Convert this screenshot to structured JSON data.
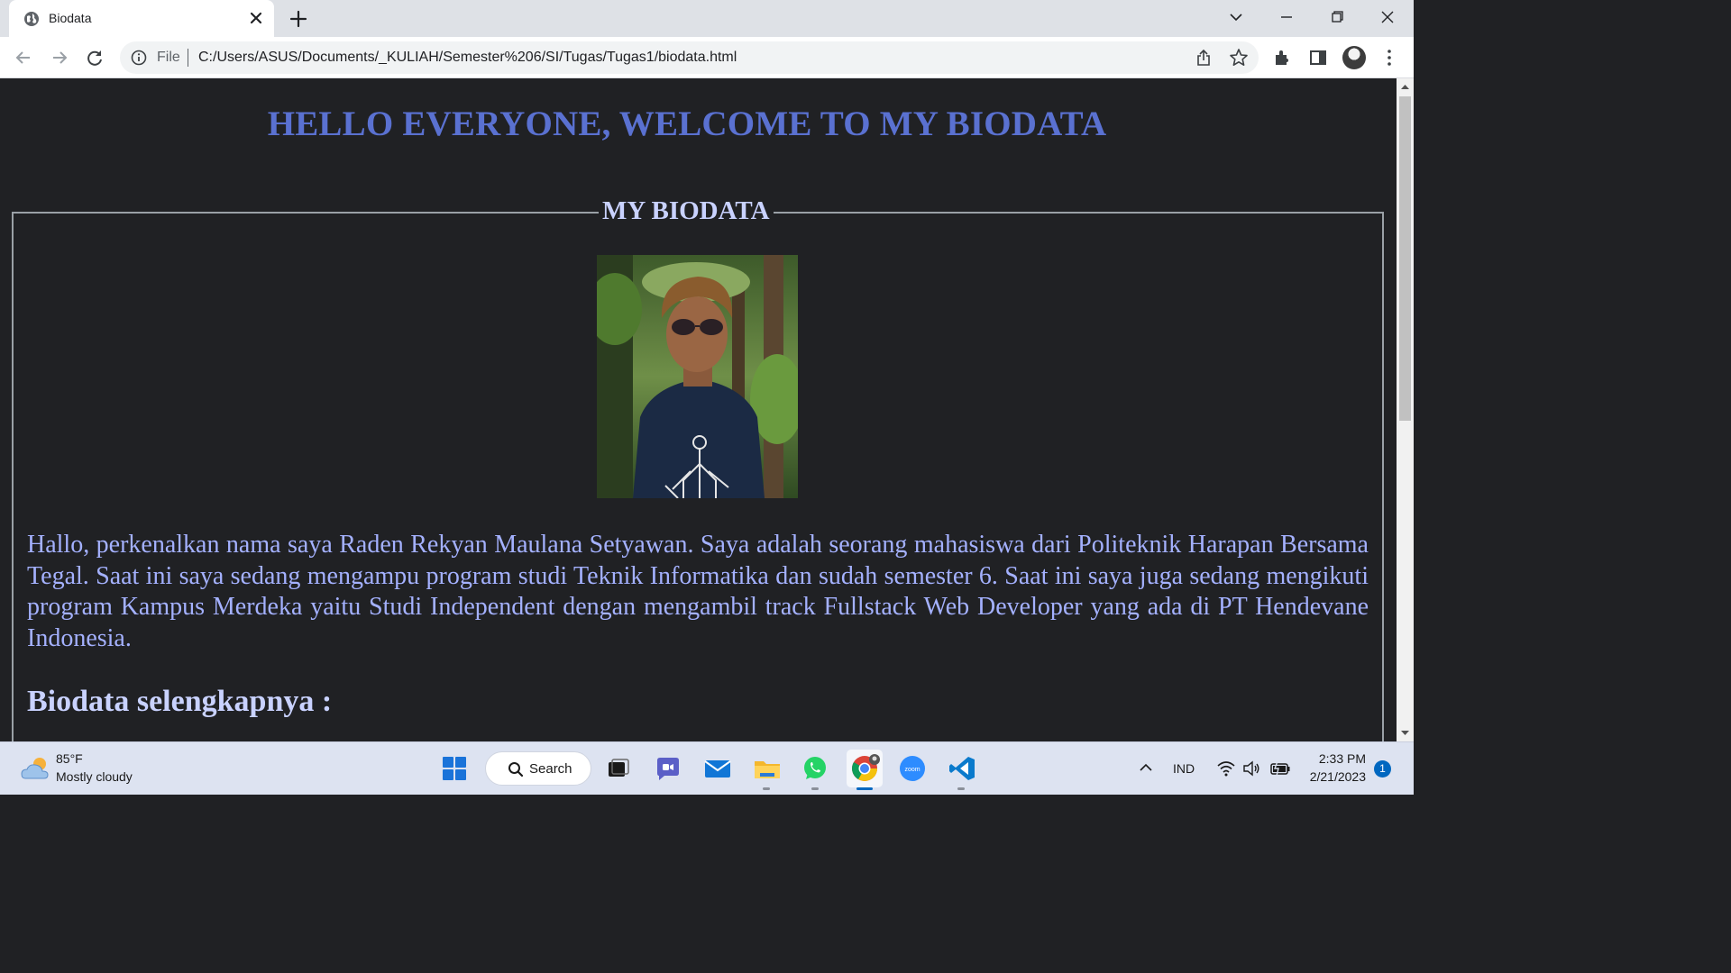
{
  "browser": {
    "tab": {
      "title": "Biodata",
      "favicon": "globe-icon"
    },
    "omnibox": {
      "scheme": "File",
      "url": "C:/Users/ASUS/Documents/_KULIAH/Semester%206/SI/Tugas/Tugas1/biodata.html"
    },
    "icons": [
      "back-icon",
      "forward-icon",
      "reload-icon",
      "info-icon",
      "share-icon",
      "star-icon",
      "extensions-icon",
      "side-panel-icon",
      "profile-avatar",
      "menu-icon"
    ]
  },
  "page": {
    "heading": "HELLO EVERYONE, WELCOME TO MY BIODATA",
    "legend": "MY BIODATA",
    "bio": "Hallo, perkenalkan nama saya Raden Rekyan Maulana Setyawan. Saya adalah seorang mahasiswa dari Politeknik Harapan Bersama Tegal. Saat ini saya sedang mengampu program studi Teknik Informatika dan sudah semester 6. Saat ini saya juga sedang mengikuti program Kampus Merdeka yaitu Studi Independent dengan mengambil track Fullstack Web Developer yang ada di PT Hendevane Indonesia.",
    "sub_heading": "Biodata selengkapnya :",
    "colors": {
      "background": "#202124",
      "heading": "#5a71d1",
      "legend": "#c9d2ff",
      "bio_text": "#a4b1ff"
    }
  },
  "taskbar": {
    "weather": {
      "temp": "85°F",
      "desc": "Mostly cloudy"
    },
    "search_label": "Search",
    "apps": [
      "file-explorer-app",
      "teams-chat-app",
      "mail-app",
      "folder-app",
      "whatsapp-app",
      "chrome-app",
      "zoom-app",
      "vscode-app"
    ],
    "tray": {
      "lang": "IND",
      "time": "2:33 PM",
      "date": "2/21/2023",
      "notifications": "1"
    }
  }
}
